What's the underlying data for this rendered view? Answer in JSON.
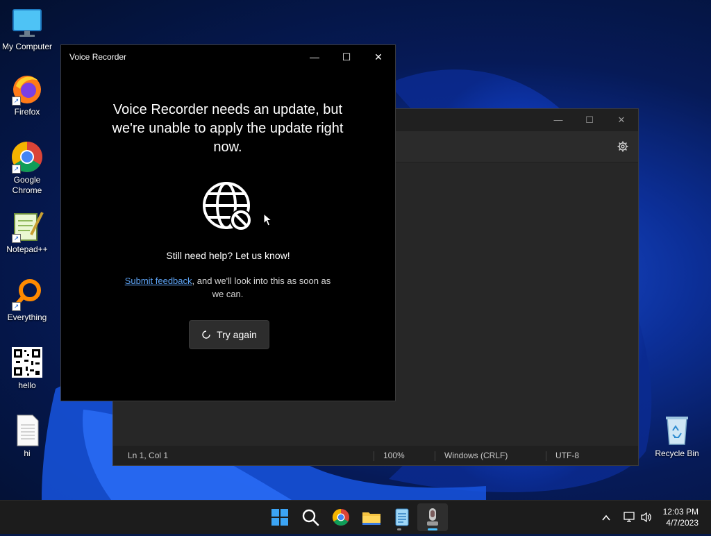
{
  "desktop": {
    "icons": [
      {
        "label": "My Computer",
        "icon": "monitor-icon"
      },
      {
        "label": "Firefox",
        "icon": "firefox-icon"
      },
      {
        "label": "Google Chrome",
        "icon": "chrome-icon"
      },
      {
        "label": "Notepad++",
        "icon": "notepadpp-icon"
      },
      {
        "label": "Everything",
        "icon": "search-magnifier-icon"
      },
      {
        "label": "hello",
        "icon": "qr-code-icon"
      },
      {
        "label": "hi",
        "icon": "text-file-icon"
      }
    ],
    "recycle_bin": {
      "label": "Recycle Bin",
      "icon": "recycle-bin-icon"
    }
  },
  "notepad": {
    "status": {
      "position": "Ln 1, Col 1",
      "zoom": "100%",
      "line_ending": "Windows (CRLF)",
      "encoding": "UTF-8"
    }
  },
  "voice_recorder": {
    "title": "Voice Recorder",
    "heading": "Voice Recorder needs an update, but we're unable to apply the update right now.",
    "help": "Still need help? Let us know!",
    "feedback_link": "Submit feedback",
    "feedback_rest": ", and we'll look into this as soon as we can.",
    "try_again": "Try again"
  },
  "taskbar": {
    "apps": [
      "start-icon",
      "search-icon",
      "chrome-icon",
      "file-explorer-icon",
      "notepad-icon",
      "voice-recorder-icon"
    ],
    "time": "12:03 PM",
    "date": "4/7/2023"
  },
  "colors": {
    "link": "#5ea4f5",
    "accent": "#4cc2ff"
  }
}
